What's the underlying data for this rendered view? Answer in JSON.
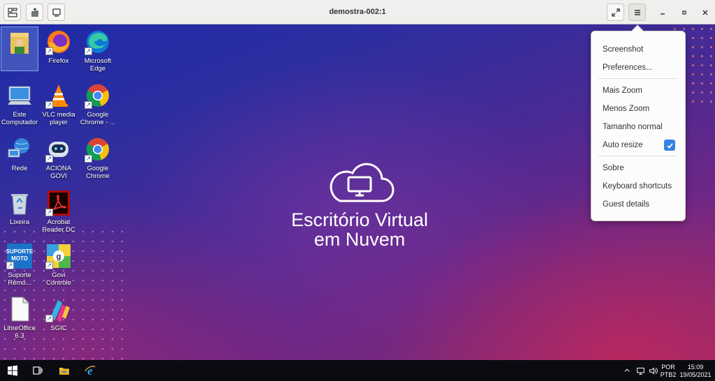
{
  "window": {
    "title": "demostra-002:1"
  },
  "desktop_icons": [
    {
      "label": ""
    },
    {
      "label": "Firefox"
    },
    {
      "label": "Microsoft Edge"
    },
    {
      "label": "Este Computador"
    },
    {
      "label": "VLC media player"
    },
    {
      "label": "Google Chrome - ..."
    },
    {
      "label": "Rede"
    },
    {
      "label": "ACIONA GOVI"
    },
    {
      "label": "Google Chrome"
    },
    {
      "label": "Lixeira"
    },
    {
      "label": "Acrobat Reader DC"
    },
    {
      "label": "Suporte Remo..."
    },
    {
      "label": "Govi Controle"
    },
    {
      "label": "LibreOffice 6.3"
    },
    {
      "label": "SGIC"
    }
  ],
  "brand": {
    "line1": "Escritório Virtual",
    "line2": "em Nuvem"
  },
  "menu": {
    "screenshot": "Screenshot",
    "preferences": "Preferences...",
    "zoom_in": "Mais Zoom",
    "zoom_out": "Menos Zoom",
    "zoom_normal": "Tamanho normal",
    "auto_resize": "Auto resize",
    "auto_resize_checked": true,
    "about": "Sobre",
    "keyboard_shortcuts": "Keyboard shortcuts",
    "guest_details": "Guest details"
  },
  "taskbar": {
    "language_1": "POR",
    "language_2": "PTB2",
    "time": "15:09",
    "date": "19/05/2021"
  },
  "colors": {
    "accent": "#3584e4",
    "taskbar": "#0b0b12"
  }
}
